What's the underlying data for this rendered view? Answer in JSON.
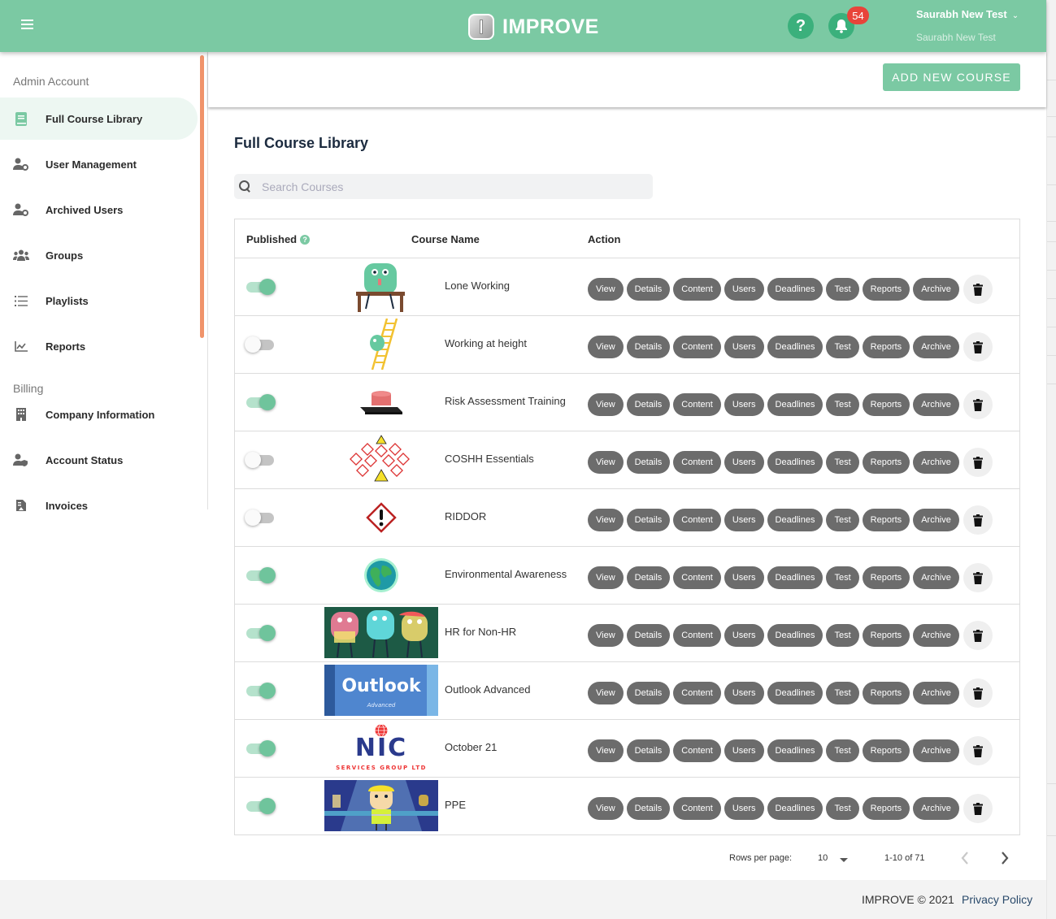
{
  "header": {
    "app_name": "IMPROVE",
    "help_icon": "question-icon",
    "notifications_icon": "bell-icon",
    "notification_count": "54",
    "user_name": "Saurabh New Test",
    "user_subtitle": "Saurabh New Test"
  },
  "sidebar": {
    "sections": [
      {
        "label": "Admin Account",
        "items": [
          {
            "label": "Full Course Library",
            "icon": "book-icon",
            "active": true
          },
          {
            "label": "User Management",
            "icon": "user-cog-icon"
          },
          {
            "label": "Archived Users",
            "icon": "user-cog-icon"
          },
          {
            "label": "Groups",
            "icon": "users-icon"
          },
          {
            "label": "Playlists",
            "icon": "list-icon"
          },
          {
            "label": "Reports",
            "icon": "chart-line-icon"
          }
        ]
      },
      {
        "label": "Billing",
        "items": [
          {
            "label": "Company Information",
            "icon": "building-icon"
          },
          {
            "label": "Account Status",
            "icon": "user-shield-icon"
          },
          {
            "label": "Invoices",
            "icon": "invoice-icon"
          }
        ]
      }
    ]
  },
  "toolbar": {
    "add_course_label": "ADD NEW COURSE"
  },
  "main": {
    "title": "Full Course Library",
    "search": {
      "placeholder": "Search Courses",
      "value": ""
    },
    "table": {
      "columns": [
        "Published",
        "Course Name",
        "Action"
      ],
      "action_labels": [
        "View",
        "Details",
        "Content",
        "Users",
        "Deadlines",
        "Test",
        "Reports",
        "Archive"
      ],
      "rows": [
        {
          "published": true,
          "name": "Lone Working",
          "thumbnail": "character-at-desk"
        },
        {
          "published": false,
          "name": "Working at height",
          "thumbnail": "character-on-ladder"
        },
        {
          "published": true,
          "name": "Risk Assessment Training",
          "thumbnail": "red-siren-light"
        },
        {
          "published": false,
          "name": "COSHH Essentials",
          "thumbnail": "hazard-symbols"
        },
        {
          "published": false,
          "name": "RIDDOR",
          "thumbnail": "warning-diamond"
        },
        {
          "published": true,
          "name": "Environmental Awareness",
          "thumbnail": "earth-globe"
        },
        {
          "published": true,
          "name": "HR for Non-HR",
          "thumbnail": "three-characters"
        },
        {
          "published": true,
          "name": "Outlook Advanced",
          "thumbnail": "outlook-advanced-banner"
        },
        {
          "published": true,
          "name": "October 21",
          "thumbnail": "nic-services-logo"
        },
        {
          "published": true,
          "name": "PPE",
          "thumbnail": "character-in-hardhat"
        }
      ]
    },
    "pagination": {
      "rows_per_page_label": "Rows per page:",
      "rows_per_page": "10",
      "range": "1-10 of 71"
    }
  },
  "thumb_text": {
    "outlook_title": "Outlook",
    "outlook_sub": "Advanced",
    "nic_logo": "NIC",
    "nic_sub": "SERVICES GROUP LTD"
  },
  "footer": {
    "copyright": "IMPROVE © 2021",
    "privacy_label": "Privacy Policy"
  },
  "colors": {
    "brand": "#7bc9a3",
    "badge": "#e8443a",
    "sidebar_scroll": "#f0936a",
    "action_pill": "#6c6c6c"
  }
}
